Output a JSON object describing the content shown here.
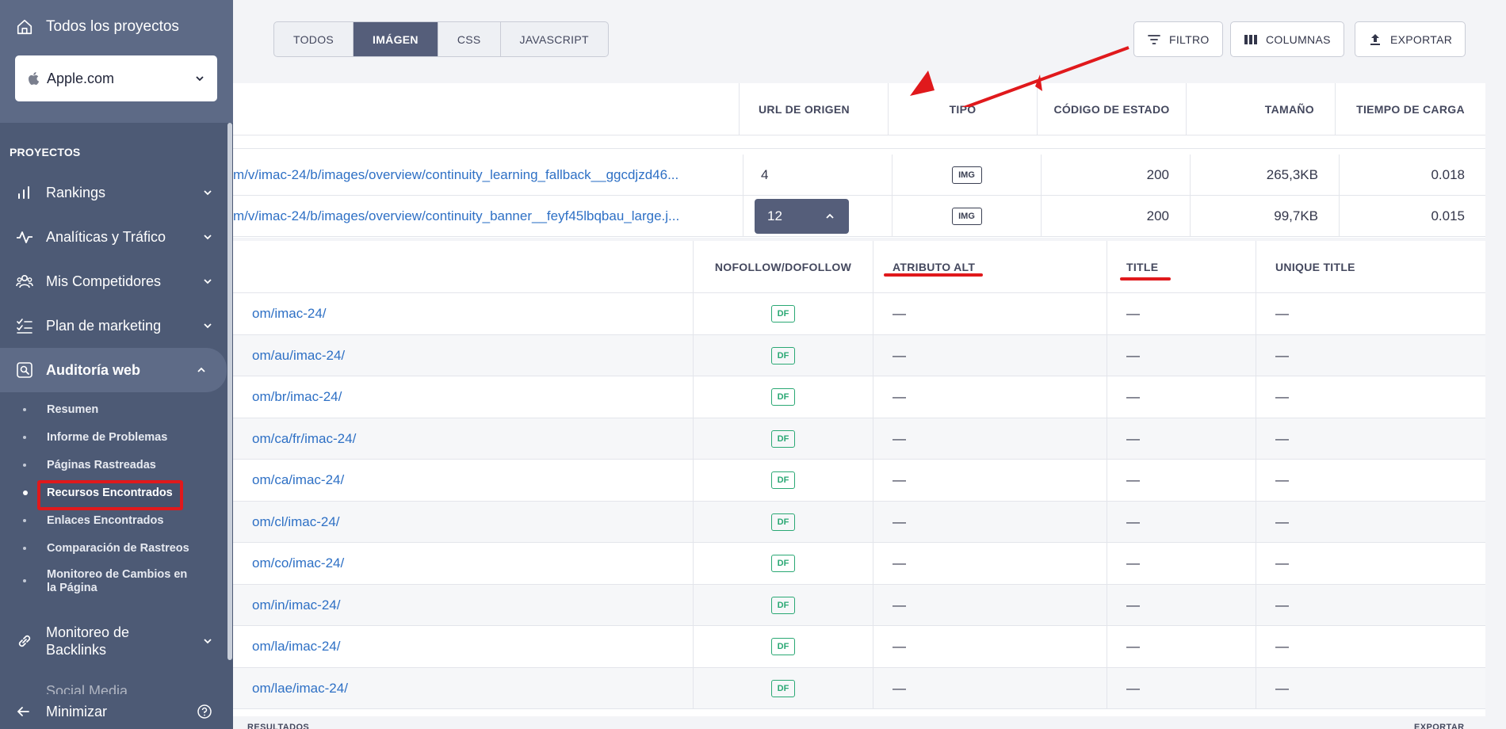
{
  "sidebar": {
    "all_projects": "Todos los proyectos",
    "project": "Apple.com",
    "heading": "PROYECTOS",
    "nav": [
      {
        "label": "Rankings",
        "icon": "bar-chart-icon"
      },
      {
        "label": "Analíticas y Tráfico",
        "icon": "pulse-icon"
      },
      {
        "label": "Mis Competidores",
        "icon": "users-icon"
      },
      {
        "label": "Plan de marketing",
        "icon": "checklist-icon"
      },
      {
        "label": "Auditoría web",
        "icon": "search-page-icon"
      }
    ],
    "sub": [
      "Resumen",
      "Informe de Problemas",
      "Páginas Rastreadas",
      "Recursos Encontrados",
      "Enlaces Encontrados",
      "Comparación de Rastreos",
      "Monitoreo de Cambios en la Página"
    ],
    "backlinks": "Monitoreo de Backlinks",
    "partial": "Social Media",
    "minimize": "Minimizar"
  },
  "tabs": [
    "TODOS",
    "IMÁGEN",
    "CSS",
    "JAVASCRIPT"
  ],
  "toolbar": {
    "filter": "FILTRO",
    "columns": "COLUMNAS",
    "export": "EXPORTAR"
  },
  "table": {
    "headers": {
      "source_url": "URL DE ORIGEN",
      "type": "TIPO",
      "status": "CÓDIGO DE ESTADO",
      "size": "TAMAÑO",
      "load": "TIEMPO DE CARGA"
    },
    "rows": [
      {
        "url": "m/v/imac-24/b/images/overview/continuity_learning_fallback__ggcdjzd46...",
        "source": "4",
        "type": "IMG",
        "status": "200",
        "size": "265,3KB",
        "load": "0.018"
      },
      {
        "url": "m/v/imac-24/b/images/overview/continuity_banner__feyf45lbqbau_large.j...",
        "source": "12",
        "type": "IMG",
        "status": "200",
        "size": "99,7KB",
        "load": "0.015"
      }
    ]
  },
  "subtable": {
    "headers": {
      "follow": "NOFOLLOW/DOFOLLOW",
      "alt": "ATRIBUTO ALT",
      "title": "TITLE",
      "unique": "UNIQUE TITLE"
    },
    "rows": [
      {
        "url": "om/imac-24/",
        "follow": "DF",
        "alt": "—",
        "title": "—",
        "unique": "—"
      },
      {
        "url": "om/au/imac-24/",
        "follow": "DF",
        "alt": "—",
        "title": "—",
        "unique": "—"
      },
      {
        "url": "om/br/imac-24/",
        "follow": "DF",
        "alt": "—",
        "title": "—",
        "unique": "—"
      },
      {
        "url": "om/ca/fr/imac-24/",
        "follow": "DF",
        "alt": "—",
        "title": "—",
        "unique": "—"
      },
      {
        "url": "om/ca/imac-24/",
        "follow": "DF",
        "alt": "—",
        "title": "—",
        "unique": "—"
      },
      {
        "url": "om/cl/imac-24/",
        "follow": "DF",
        "alt": "—",
        "title": "—",
        "unique": "—"
      },
      {
        "url": "om/co/imac-24/",
        "follow": "DF",
        "alt": "—",
        "title": "—",
        "unique": "—"
      },
      {
        "url": "om/in/imac-24/",
        "follow": "DF",
        "alt": "—",
        "title": "—",
        "unique": "—"
      },
      {
        "url": "om/la/imac-24/",
        "follow": "DF",
        "alt": "—",
        "title": "—",
        "unique": "—"
      },
      {
        "url": "om/lae/imac-24/",
        "follow": "DF",
        "alt": "—",
        "title": "—",
        "unique": "—"
      }
    ]
  },
  "footer": {
    "results": "RESULTADOS",
    "export": "EXPORTAR"
  },
  "colors": {
    "sidebar": "#4d5a75",
    "accent": "#555e7a",
    "link": "#2e70c5",
    "df": "#2aa874",
    "annotation": "#e0191c"
  }
}
